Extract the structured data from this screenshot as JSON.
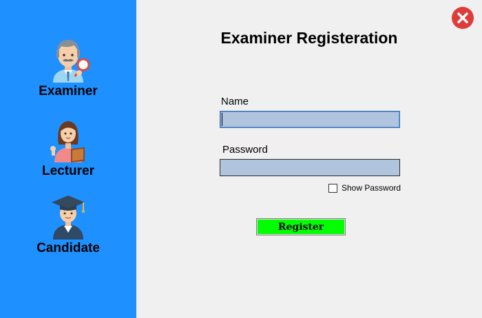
{
  "sidebar": {
    "items": [
      {
        "label": "Examiner",
        "icon": "examiner-icon"
      },
      {
        "label": "Lecturer",
        "icon": "lecturer-icon"
      },
      {
        "label": "Candidate",
        "icon": "candidate-icon"
      }
    ],
    "background": "#1e90ff"
  },
  "form": {
    "title": "Examiner Registeration",
    "name_label": "Name",
    "name_value": "",
    "password_label": "Password",
    "password_value": "",
    "show_password_label": "Show Password",
    "show_password_checked": false,
    "register_label": "Register",
    "input_background": "#b0c4de",
    "register_color": "#00ff00"
  },
  "window": {
    "close_icon": "close-icon",
    "close_color": "#e03b3b"
  }
}
